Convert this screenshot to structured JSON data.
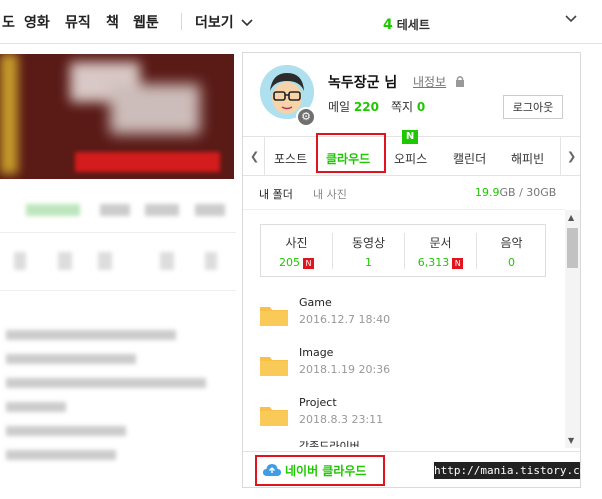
{
  "topnav": {
    "items": [
      "도",
      "영화",
      "뮤직",
      "책",
      "웹툰",
      "더보기"
    ],
    "weather_num": "4",
    "weather_label": "테세트"
  },
  "profile": {
    "username": "녹두장군 님",
    "myinfo": "내정보",
    "mail_label": "메일",
    "mail_count": "220",
    "note_label": "쪽지",
    "note_count": "0",
    "logout": "로그아웃"
  },
  "tabs": {
    "items": [
      "포스트",
      "클라우드",
      "오피스",
      "캘린더",
      "해피빈"
    ],
    "active": "클라우드",
    "new_badge": "N"
  },
  "folderbar": {
    "my_folder": "내 폴더",
    "my_photo": "내 사진",
    "used": "19.9",
    "used_unit": "GB",
    "total": " / 30GB"
  },
  "stats": [
    {
      "label": "사진",
      "value": "205",
      "new": "N"
    },
    {
      "label": "동영상",
      "value": "1",
      "new": ""
    },
    {
      "label": "문서",
      "value": "6,313",
      "new": "N"
    },
    {
      "label": "음악",
      "value": "0",
      "new": ""
    }
  ],
  "files": [
    {
      "name": "Game",
      "date": "2016.12.7 18:40"
    },
    {
      "name": "Image",
      "date": "2018.1.19 20:36"
    },
    {
      "name": "Project",
      "date": "2018.8.3 23:11"
    },
    {
      "name": "각종드라이버",
      "date": ""
    }
  ],
  "bottom": {
    "cloud_link": "네이버 클라우드"
  },
  "watermark": "http://mania.tistory.com",
  "colors": {
    "accent": "#1ec800",
    "highlight": "#e1131c",
    "folder": "#f7c04a"
  }
}
